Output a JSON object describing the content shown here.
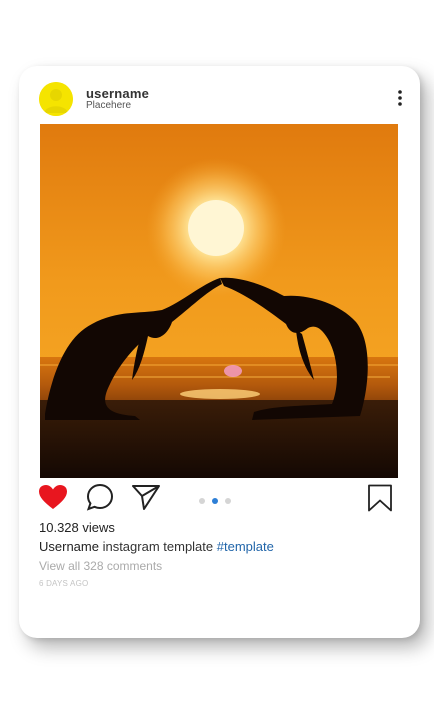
{
  "post": {
    "username": "username",
    "subtitle": "Placehere",
    "views": "10.328 views",
    "caption_user": "Username",
    "caption_text": " instagram template ",
    "caption_hashtag": "#template",
    "comments_link": "View all 328 comments",
    "time_ago": "6 DAYS AGO"
  },
  "carousel": {
    "count": 3,
    "active_index": 1
  },
  "icons": {
    "avatar": "user-avatar-icon",
    "more": "vertical-ellipsis-icon",
    "like": "heart-icon",
    "comment": "speech-bubble-icon",
    "share": "paper-plane-icon",
    "save": "bookmark-icon"
  },
  "colors": {
    "like_active": "#e8161f",
    "avatar_bg": "#f5e400",
    "hashtag": "#2266aa",
    "dot_active": "#2d7fd6"
  }
}
